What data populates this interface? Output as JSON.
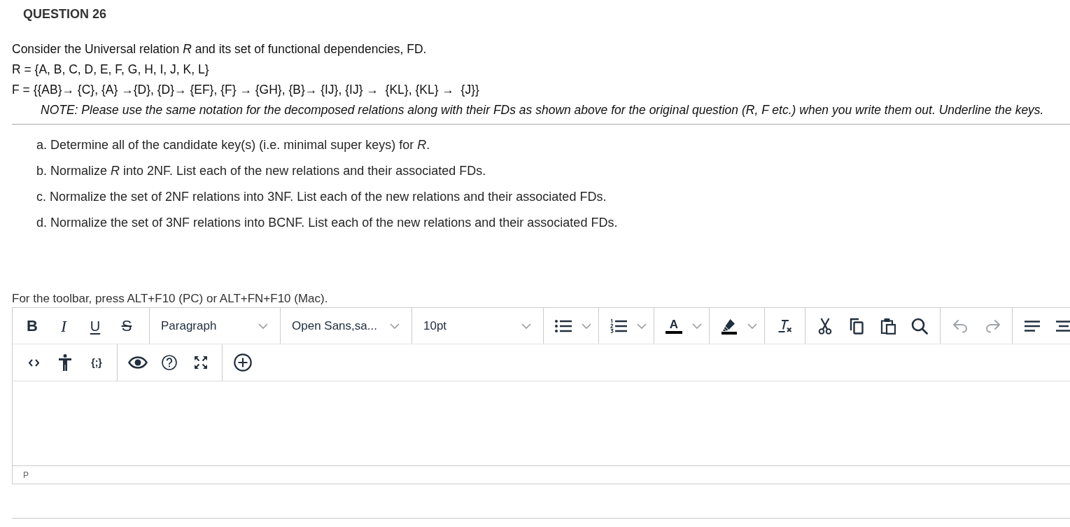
{
  "question": {
    "title": "QUESTION 26",
    "intro": [
      "Consider the Universal relation *R* and its set of functional dependencies, FD.",
      "R = {A, B, C, D, E, F, G, H, I, J, K, L}",
      "F = {{AB}→ {C}, {A} →{D}, {D}→ {EF}, {F} → {GH}, {B}→ {IJ}, {IJ} →  {KL}, {KL} →  {J}}"
    ],
    "note": "NOTE: Please use the same notation for the decomposed relations along with their FDs as shown above for the original question (R, F etc.) when you write them out. Underline the keys.",
    "parts": [
      "a. Determine all of the candidate key(s) (i.e. minimal super keys) for *R*.",
      "b. Normalize *R* into 2NF. List each of the new relations and their associated FDs.",
      "c. Normalize the set of 2NF relations into 3NF. List each of the new relations and their associated FDs.",
      "d. Normalize the set of 3NF relations into BCNF. List each of the new relations and their associated FDs."
    ]
  },
  "editor": {
    "toolbar_hint": "For the toolbar, press ALT+F10 (PC) or ALT+FN+F10 (Mac).",
    "toolbar_rows": [
      [
        [
          {
            "kind": "bold",
            "label": "B",
            "disabled": false
          },
          {
            "kind": "italic",
            "label": "I",
            "disabled": false
          },
          {
            "kind": "underline",
            "label": "U",
            "disabled": false
          },
          {
            "kind": "strikethrough",
            "label": "S",
            "disabled": false
          }
        ],
        [
          {
            "kind": "format-select",
            "value": "Paragraph",
            "disabled": false
          }
        ],
        [
          {
            "kind": "font-select",
            "value": "Open Sans,sa...",
            "disabled": false
          }
        ],
        [
          {
            "kind": "size-select",
            "value": "10pt",
            "disabled": false
          }
        ],
        [
          {
            "kind": "bullet-list",
            "disabled": false
          }
        ],
        [
          {
            "kind": "numbered-list",
            "disabled": false
          }
        ],
        [
          {
            "kind": "text-color",
            "label": "A",
            "disabled": false
          }
        ],
        [
          {
            "kind": "highlight",
            "disabled": false
          }
        ],
        [
          {
            "kind": "clear-format",
            "disabled": false
          }
        ],
        [
          {
            "kind": "cut",
            "disabled": false
          },
          {
            "kind": "copy",
            "disabled": false
          },
          {
            "kind": "paste",
            "disabled": false
          },
          {
            "kind": "find",
            "disabled": false
          }
        ],
        [
          {
            "kind": "undo",
            "disabled": true
          },
          {
            "kind": "redo",
            "disabled": true
          }
        ],
        [
          {
            "kind": "align-left",
            "disabled": false
          },
          {
            "kind": "align-center",
            "disabled": false
          }
        ]
      ],
      [
        [
          {
            "kind": "code",
            "disabled": false
          },
          {
            "kind": "accessibility",
            "disabled": false
          },
          {
            "kind": "code-sample",
            "label": "{;}",
            "disabled": false
          }
        ],
        [
          {
            "kind": "preview",
            "disabled": false
          },
          {
            "kind": "help",
            "disabled": false
          },
          {
            "kind": "fullscreen",
            "disabled": false
          }
        ],
        [
          {
            "kind": "insert",
            "disabled": false
          }
        ]
      ]
    ],
    "status_path": "P"
  }
}
